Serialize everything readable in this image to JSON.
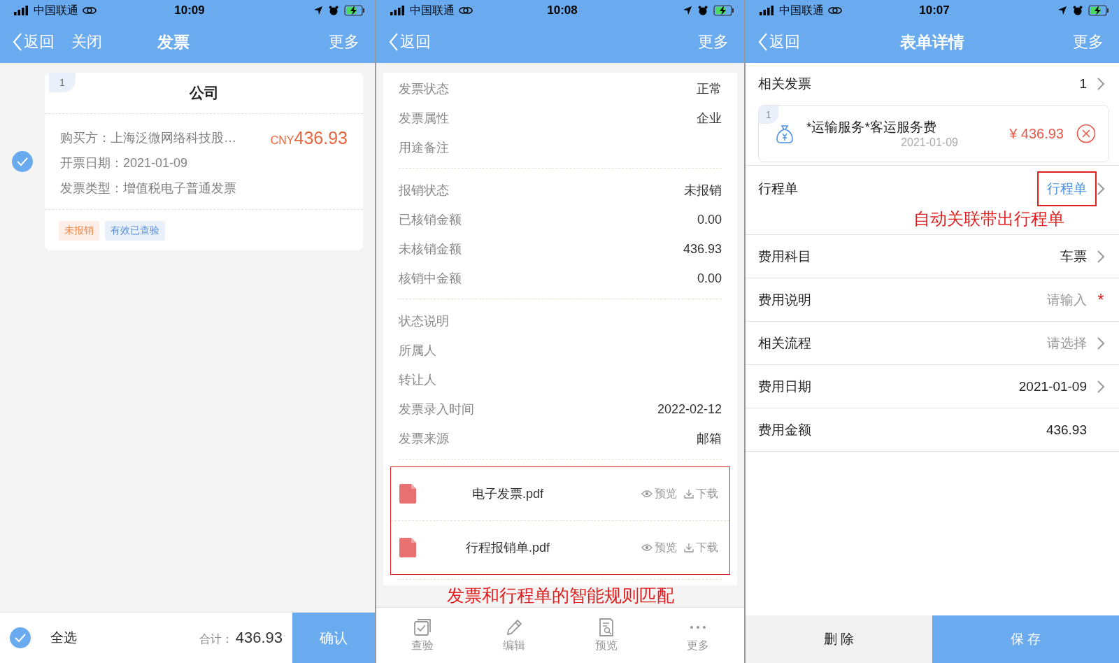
{
  "screens": [
    {
      "kind": "invoice_list",
      "status_bar": {
        "carrier": "中国联通",
        "time": "10:09"
      },
      "nav": {
        "back": "返回",
        "close": "关闭",
        "title": "发票",
        "more": "更多"
      },
      "cards": [
        {
          "index": "1",
          "title": "公司",
          "selected": true,
          "buyer": "购买方：上海泛微网络科技股…",
          "currency": "CNY",
          "amount": "436.93",
          "date": "开票日期：2021-01-09",
          "type": "发票类型：增值税电子普通发票",
          "tags": [
            {
              "label": "未报销",
              "color": "#f0884a"
            },
            {
              "label": "有效已查验",
              "color": "#5b8fd6"
            }
          ]
        }
      ],
      "footer": {
        "select_all": "全选",
        "checked": true,
        "total_label": "合计：",
        "total": "436.93",
        "confirm": "确认"
      }
    },
    {
      "kind": "invoice_detail",
      "status_bar": {
        "carrier": "中国联通",
        "time": "10:08"
      },
      "nav": {
        "back": "返回",
        "more": "更多"
      },
      "sections": [
        [
          {
            "label": "发票状态",
            "value": "正常"
          },
          {
            "label": "发票属性",
            "value": "企业"
          },
          {
            "label": "用途备注"
          }
        ],
        [
          {
            "label": "报销状态",
            "value": "未报销"
          },
          {
            "label": "已核销金额",
            "value": "0.00"
          },
          {
            "label": "未核销金额",
            "value": "436.93"
          },
          {
            "label": "核销中金额",
            "value": "0.00"
          }
        ],
        [
          {
            "label": "状态说明"
          },
          {
            "label": "所属人"
          },
          {
            "label": "转让人"
          },
          {
            "label": "发票录入时间",
            "value": "2022-02-12"
          },
          {
            "label": "发票来源",
            "value": "邮箱"
          }
        ]
      ],
      "attachments": [
        {
          "name": "电子发票.pdf",
          "preview": "预览",
          "download": "下载"
        },
        {
          "name": "行程报销单.pdf",
          "preview": "预览",
          "download": "下载"
        }
      ],
      "annotation": "发票和行程单的智能规则匹配",
      "toolbar": [
        {
          "kind": "verify",
          "label": "查验"
        },
        {
          "kind": "edit",
          "label": "编辑"
        },
        {
          "kind": "preview",
          "label": "预览"
        },
        {
          "kind": "more",
          "label": "更多"
        }
      ]
    },
    {
      "kind": "form_detail",
      "status_bar": {
        "carrier": "中国联通",
        "time": "10:07"
      },
      "nav": {
        "back": "返回",
        "title": "表单详情",
        "more": "更多"
      },
      "invoice_row": {
        "label": "相关发票",
        "value": "1"
      },
      "invoice_card": {
        "index": "1",
        "name": "*运输服务*客运服务费",
        "date": "2021-01-09",
        "amount": "¥ 436.93"
      },
      "rows": [
        {
          "label": "行程单",
          "value": "行程单",
          "kind": "link",
          "chevron": true,
          "highlighted": true,
          "annotation": "自动关联带出行程单"
        },
        {
          "label": "费用科目",
          "value": "车票",
          "kind": "value",
          "chevron": true,
          "highlighted": false
        },
        {
          "label": "费用说明",
          "value": "请输入",
          "kind": "placeholder",
          "chevron": false,
          "highlighted": false,
          "required_mark": "*"
        },
        {
          "label": "相关流程",
          "value": "请选择",
          "kind": "placeholder",
          "chevron": true,
          "highlighted": false
        },
        {
          "label": "费用日期",
          "value": "2021-01-09",
          "kind": "value",
          "chevron": true,
          "highlighted": false
        },
        {
          "label": "费用金额",
          "value": "436.93",
          "kind": "value",
          "chevron": false,
          "highlighted": false
        }
      ],
      "buttons": [
        {
          "kind": "secondary",
          "label": "删 除"
        },
        {
          "kind": "primary",
          "label": "保 存"
        }
      ]
    }
  ]
}
